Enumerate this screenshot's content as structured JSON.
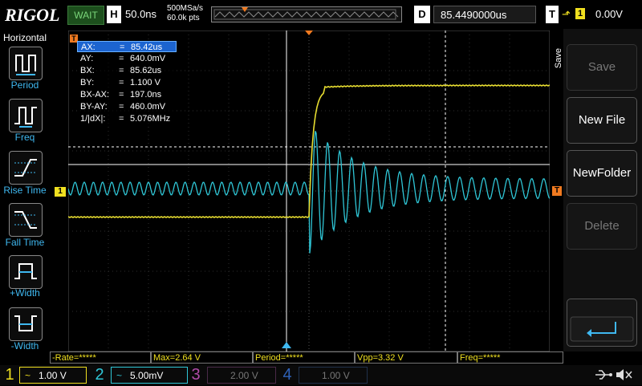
{
  "header": {
    "logo": "RIGOL",
    "run_status": "WAIT",
    "horizontal_label": "H",
    "timebase": "50.0ns",
    "sample_rate": "500MSa/s",
    "memory_depth": "60.0k pts",
    "delay_label": "D",
    "delay_value": "85.4490000us",
    "trigger_label": "T",
    "trigger_edge": "⬏",
    "trigger_source": "1",
    "trigger_level": "0.00V"
  },
  "left_menu": {
    "title": "Horizontal",
    "items": [
      {
        "label": "Period",
        "icon": "period-icon"
      },
      {
        "label": "Freq",
        "icon": "frequency-icon"
      },
      {
        "label": "Rise Time",
        "icon": "rise-time-icon"
      },
      {
        "label": "Fall Time",
        "icon": "fall-time-icon"
      },
      {
        "label": "+Width",
        "icon": "positive-width-icon"
      },
      {
        "label": "-Width",
        "icon": "negative-width-icon"
      }
    ]
  },
  "right_menu": {
    "tab": "Save",
    "buttons": [
      {
        "label": "Save",
        "enabled": false
      },
      {
        "label": "New File",
        "enabled": true
      },
      {
        "label": "NewFolder",
        "enabled": true
      },
      {
        "label": "Delete",
        "enabled": false
      }
    ],
    "return_icon": "return-arrow-icon"
  },
  "cursor_readout": [
    {
      "name": "AX:",
      "value": "85.42us"
    },
    {
      "name": "AY:",
      "value": "640.0mV"
    },
    {
      "name": "BX:",
      "value": "85.62us"
    },
    {
      "name": "BY:",
      "value": "1.100 V"
    },
    {
      "name": "BX-AX:",
      "value": "197.0ns"
    },
    {
      "name": "BY-AY:",
      "value": "460.0mV"
    },
    {
      "name": "1/|dX|:",
      "value": "5.076MHz"
    }
  ],
  "cursor_eq": "=",
  "measurements": [
    "-Rate=*****",
    "Max=2.64 V",
    "Period=*****",
    "Vpp=3.32 V",
    "Freq=*****"
  ],
  "channels": [
    {
      "num": "1",
      "coupling": "~",
      "scale": "1.00 V",
      "color": "#f0e020",
      "active": true
    },
    {
      "num": "2",
      "coupling": "~",
      "scale": "5.00mV",
      "color": "#2fc6d6",
      "active": true
    },
    {
      "num": "3",
      "coupling": "",
      "scale": "2.00 V",
      "color": "#b04aa8",
      "active": false
    },
    {
      "num": "4",
      "coupling": "",
      "scale": "1.00 V",
      "color": "#2f62b8",
      "active": false
    }
  ],
  "markers": {
    "ch1_marker": "1",
    "trigger_marker": "T",
    "top_left_marker": "T"
  },
  "status_icons": {
    "usb": "usb-icon",
    "mute": "speaker-mute-icon"
  }
}
